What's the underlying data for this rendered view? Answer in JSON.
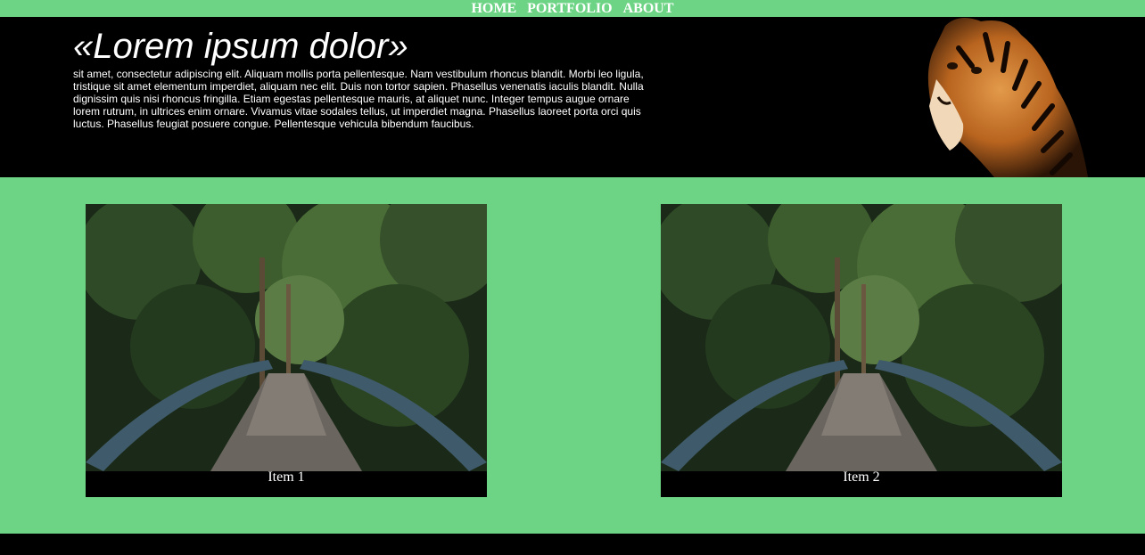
{
  "nav": {
    "items": [
      "HOME",
      "PORTFOLIO",
      "ABOUT"
    ]
  },
  "hero": {
    "title": "«Lorem ipsum dolor»",
    "text": "sit amet, consectetur adipiscing elit. Aliquam mollis porta pellentesque. Nam vestibulum rhoncus blandit. Morbi leo ligula, tristique sit amet elementum imperdiet, aliquam nec elit. Duis non tortor sapien. Phasellus venenatis iaculis blandit. Nulla dignissim quis nisi rhoncus fringilla. Etiam egestas pellentesque mauris, at aliquet nunc. Integer tempus augue ornare lorem rutrum, in ultrices enim ornare. Vivamus vitae sodales tellus, ut imperdiet magna. Phasellus laoreet porta orci quis luctus. Phasellus feugiat posuere congue. Pellentesque vehicula bibendum faucibus."
  },
  "gallery": {
    "items": [
      {
        "caption": "Item 1"
      },
      {
        "caption": "Item 2"
      }
    ]
  },
  "colors": {
    "background": "#6cd484",
    "hero_bg": "#000000",
    "footer_bg": "#000000"
  }
}
